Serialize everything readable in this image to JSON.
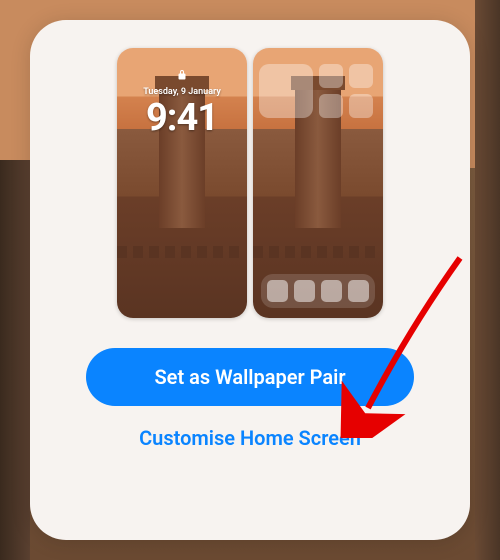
{
  "lock_screen": {
    "date": "Tuesday, 9 January",
    "time": "9:41"
  },
  "buttons": {
    "primary": "Set as Wallpaper Pair",
    "secondary": "Customise Home Screen"
  },
  "colors": {
    "primary_button_bg": "#0a84ff",
    "link_color": "#0a84ff"
  }
}
